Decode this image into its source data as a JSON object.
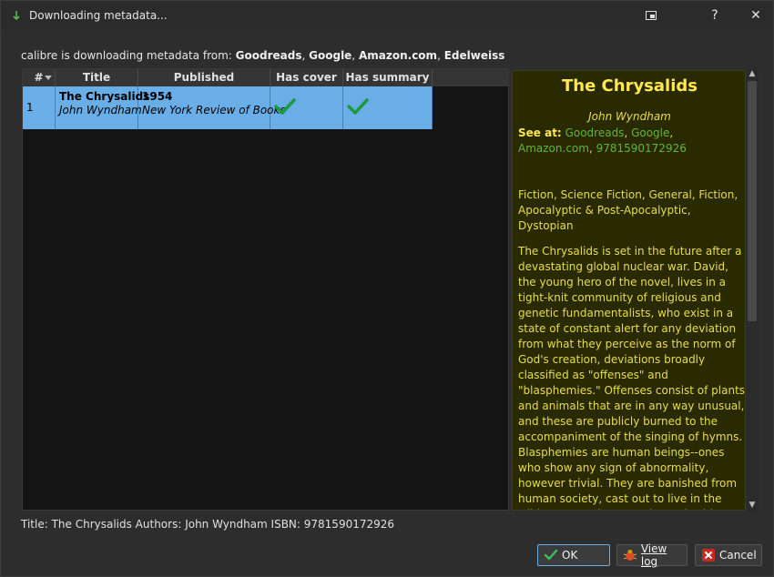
{
  "window": {
    "title": "Downloading metadata...",
    "help_label": "?",
    "close_label": "✕"
  },
  "sources": {
    "prefix": "calibre is downloading metadata from:",
    "list": [
      "Goodreads",
      "Google",
      "Amazon.com",
      "Edelweiss"
    ]
  },
  "table": {
    "headers": [
      "#",
      "Title",
      "Published",
      "Has cover",
      "Has summary"
    ],
    "rows": [
      {
        "num": "1",
        "title": "The Chrysalids",
        "author": "John Wyndham",
        "year": "1954",
        "publisher": "New York Review of Books",
        "has_cover": true,
        "has_summary": true
      }
    ]
  },
  "detail": {
    "title": "The Chrysalids",
    "author": "John Wyndham",
    "see_at_label": "See at:",
    "links": [
      "Goodreads",
      "Google",
      "Amazon.com",
      "9781590172926"
    ],
    "tags": "Fiction, Science Fiction, General, Fiction, Apocalyptic & Post-Apocalyptic, Dystopian",
    "summary": "The Chrysalids is set in the future after a devastating global nuclear war. David, the young hero of the novel, lives in a tight-knit community of religious and genetic fundamentalists, who exist in a state of constant alert for any deviation from what they perceive as the norm of God's creation, deviations broadly classified as \"offenses\" and \"blasphemies.\" Offenses consist of plants and animals that are in any way unusual, and these are publicly burned to the accompaniment of the singing of hymns. Blasphemies are human beings--ones who show any sign of abnormality, however trivial. They are banished from human society, cast out to live in the wild country where, as the authorities see things, invisible and the"
  },
  "status": "Title: The Chrysalids Authors: John Wyndham ISBN: 9781590172926",
  "buttons": {
    "ok": "OK",
    "view_log": "View log",
    "cancel": "Cancel"
  },
  "colors": {
    "selection": "#6aaee8",
    "detail_bg": "#2a2a00",
    "detail_text": "#e8dc50",
    "link": "#64b43c",
    "check": "#1e9a3c"
  }
}
